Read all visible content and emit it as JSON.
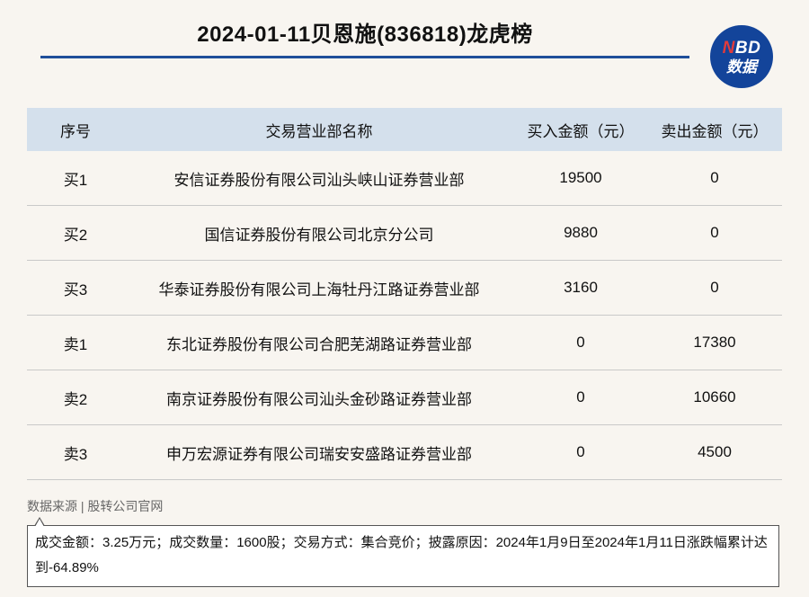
{
  "header": {
    "title": "2024-01-11贝恩施(836818)龙虎榜",
    "logo": {
      "line1_accent": "N",
      "line1_rest": "BD",
      "line2": "数据"
    }
  },
  "table": {
    "columns": [
      "序号",
      "交易营业部名称",
      "买入金额（元）",
      "卖出金额（元）"
    ],
    "rows": [
      [
        "买1",
        "安信证券股份有限公司汕头峡山证券营业部",
        "19500",
        "0"
      ],
      [
        "买2",
        "国信证券股份有限公司北京分公司",
        "9880",
        "0"
      ],
      [
        "买3",
        "华泰证券股份有限公司上海牡丹江路证券营业部",
        "3160",
        "0"
      ],
      [
        "卖1",
        "东北证券股份有限公司合肥芜湖路证券营业部",
        "0",
        "17380"
      ],
      [
        "卖2",
        "南京证券股份有限公司汕头金砂路证券营业部",
        "0",
        "10660"
      ],
      [
        "卖3",
        "申万宏源证券有限公司瑞安安盛路证券营业部",
        "0",
        "4500"
      ]
    ]
  },
  "footer": {
    "source": "数据来源 | 股转公司官网",
    "note": "成交金额：3.25万元；成交数量：1600股；交易方式：集合竞价；披露原因：2024年1月9日至2024年1月11日涨跌幅累计达到-64.89%"
  },
  "colors": {
    "accent": "#1f4f9a",
    "header_bg": "#d4e0ec",
    "logo_bg": "#13449a",
    "logo_accent": "#e23b3b"
  }
}
